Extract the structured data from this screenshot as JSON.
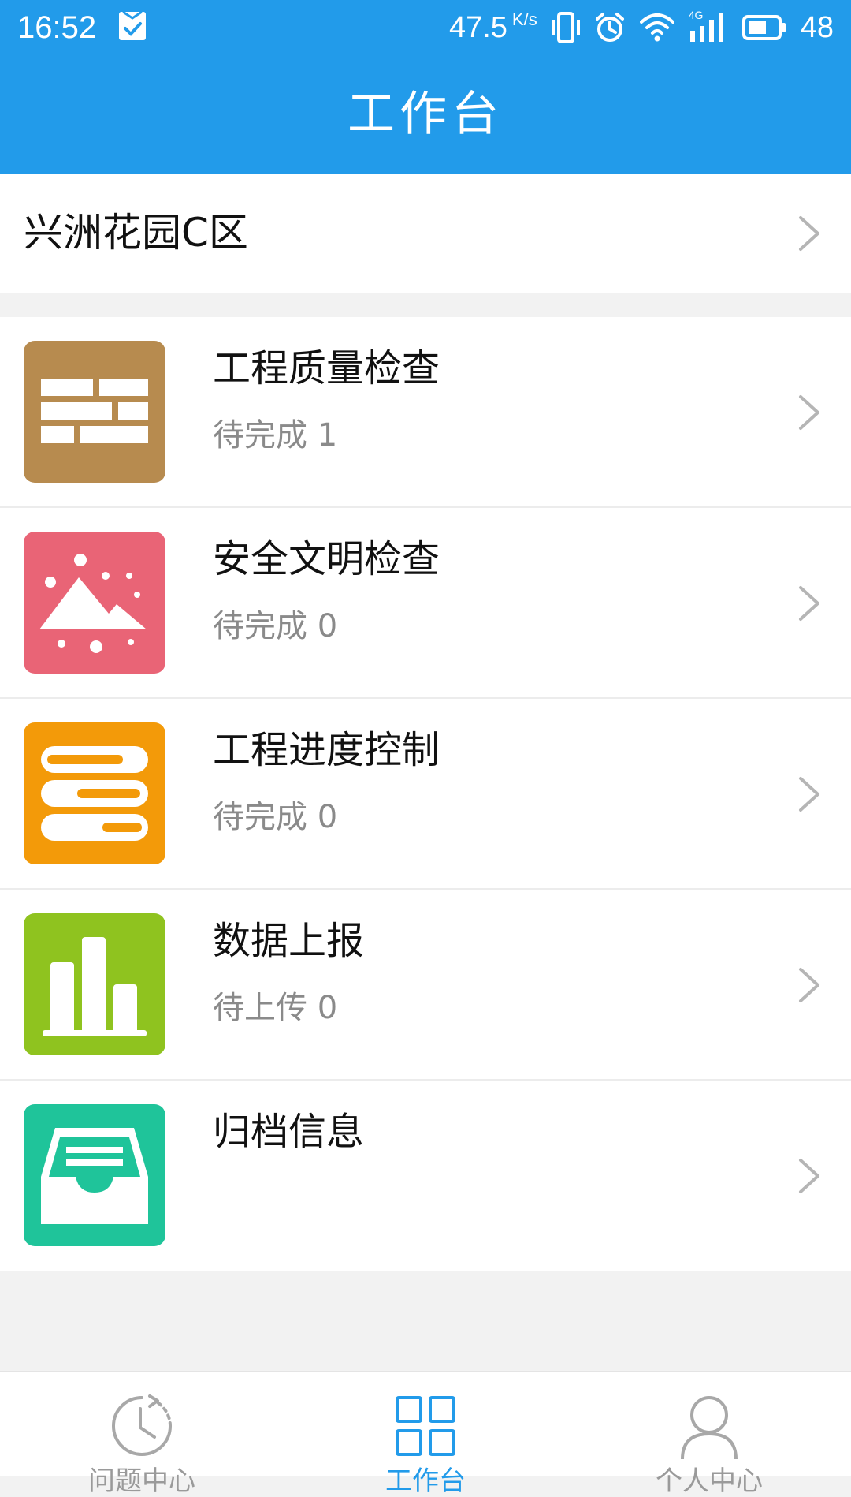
{
  "status_bar": {
    "time": "16:52",
    "speed_value": "47.5",
    "speed_unit": "K/s",
    "battery": "48",
    "network_label": "4G",
    "icons": [
      "task-check-icon",
      "vibrate-icon",
      "alarm-icon",
      "wifi-icon",
      "signal-4g-icon",
      "battery-icon"
    ]
  },
  "header": {
    "title": "工作台"
  },
  "project": {
    "name": "兴洲花园C区"
  },
  "items": [
    {
      "title": "工程质量检查",
      "subtitle": "待完成 1",
      "icon": "brick-wall-icon",
      "color": "#b78b4f"
    },
    {
      "title": "安全文明检查",
      "subtitle": "待完成 0",
      "icon": "mountain-dust-icon",
      "color": "#e96476"
    },
    {
      "title": "工程进度控制",
      "subtitle": "待完成 0",
      "icon": "progress-bars-icon",
      "color": "#f39a09"
    },
    {
      "title": "数据上报",
      "subtitle": "待上传 0",
      "icon": "bar-chart-icon",
      "color": "#8fc31f"
    },
    {
      "title": "归档信息",
      "subtitle": "",
      "icon": "archive-tray-icon",
      "color": "#1fc49a"
    }
  ],
  "tabs": [
    {
      "label": "问题中心",
      "icon": "history-clock-icon",
      "active": false
    },
    {
      "label": "工作台",
      "icon": "grid-icon",
      "active": true
    },
    {
      "label": "个人中心",
      "icon": "person-icon",
      "active": false
    }
  ],
  "colors": {
    "header": "#229bea",
    "tab_active": "#229bea",
    "tab_inactive": "#9a9a9a"
  }
}
